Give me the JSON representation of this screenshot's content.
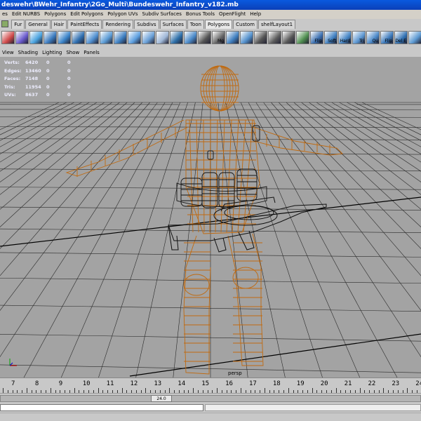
{
  "window": {
    "title": "deswehr\\BWehr_Infantry\\2Go_Multi\\Bundeswehr_Infantry_v182.mb"
  },
  "menubar": [
    "es",
    "Edit NURBS",
    "Polygons",
    "Edit Polygons",
    "Polygon UVs",
    "Subdiv Surfaces",
    "Bonus Tools",
    "OpenFlight",
    "Help"
  ],
  "shelf": {
    "tabs": [
      {
        "label": "Fur",
        "active": false
      },
      {
        "label": "General",
        "active": false
      },
      {
        "label": "Hair",
        "active": false
      },
      {
        "label": "PaintEffects",
        "active": false
      },
      {
        "label": "Rendering",
        "active": false
      },
      {
        "label": "Subdivs",
        "active": false
      },
      {
        "label": "Surfaces",
        "active": false
      },
      {
        "label": "Toon",
        "active": false
      },
      {
        "label": "Polygons",
        "active": true
      },
      {
        "label": "Custom",
        "active": false
      },
      {
        "label": "shelfLayout1",
        "active": false
      }
    ],
    "icons": [
      {
        "name": "cube-icon",
        "color": "#d04a4a",
        "label": ""
      },
      {
        "name": "cube-solid-icon",
        "color": "#6a5acd",
        "label": ""
      },
      {
        "name": "sphere-icon",
        "color": "#4aa3df",
        "label": ""
      },
      {
        "name": "cylinder-icon",
        "color": "#3b7bbf",
        "label": ""
      },
      {
        "name": "plane-icon",
        "color": "#3a83c9",
        "label": ""
      },
      {
        "name": "pipe-icon",
        "color": "#2f6fb0",
        "label": ""
      },
      {
        "name": "torus-icon",
        "color": "#4f8fd0",
        "label": ""
      },
      {
        "name": "extrude-icon",
        "color": "#5b9bd5",
        "label": ""
      },
      {
        "name": "bevel-icon",
        "color": "#3d7fc1",
        "label": ""
      },
      {
        "name": "merge-icon",
        "color": "#5d9fe0",
        "label": ""
      },
      {
        "name": "split-icon",
        "color": "#6aa0d8",
        "label": ""
      },
      {
        "name": "smooth-icon",
        "color": "#a0b8d8",
        "label": ""
      },
      {
        "name": "wedge-icon",
        "color": "#2c6ea8",
        "label": ""
      },
      {
        "name": "bridge-icon",
        "color": "#4a89c8",
        "label": ""
      },
      {
        "name": "checker-icon",
        "color": "#555555",
        "label": ""
      },
      {
        "name": "checker-icon",
        "color": "#666666",
        "label": "Mg"
      },
      {
        "name": "combine-icon",
        "color": "#3f7fc0",
        "label": ""
      },
      {
        "name": "separate-icon",
        "color": "#5290cc",
        "label": ""
      },
      {
        "name": "checker-icon",
        "color": "#555555",
        "label": ""
      },
      {
        "name": "checker-icon",
        "color": "#5c5c5c",
        "label": ""
      },
      {
        "name": "checker-icon",
        "color": "#575757",
        "label": ""
      },
      {
        "name": "grid-icon",
        "color": "#4f8f4f",
        "label": ""
      },
      {
        "name": "flip-icon",
        "color": "#3a6fb0",
        "label": "Flip"
      },
      {
        "name": "soft-icon",
        "color": "#3f7fc0",
        "label": "Soft"
      },
      {
        "name": "hard-icon",
        "color": "#4585c5",
        "label": "Hard"
      },
      {
        "name": "triangulate-icon",
        "color": "#5a95d0",
        "label": "Tri"
      },
      {
        "name": "quad-icon",
        "color": "#4a88c8",
        "label": "Qu"
      },
      {
        "name": "flip-edge-icon",
        "color": "#3b79bb",
        "label": "Flip"
      },
      {
        "name": "delete-edge-icon",
        "color": "#3171b3",
        "label": "Del E"
      },
      {
        "name": "misc-icon",
        "color": "#5d9ad3",
        "label": ""
      }
    ]
  },
  "panel_menu": [
    "View",
    "Shading",
    "Lighting",
    "Show",
    "Panels"
  ],
  "hud": [
    {
      "label": "Verts:",
      "v1": "6420",
      "v2": "0",
      "v3": "0"
    },
    {
      "label": "Edges:",
      "v1": "13460",
      "v2": "0",
      "v3": "0"
    },
    {
      "label": "Faces:",
      "v1": "7148",
      "v2": "0",
      "v3": "0"
    },
    {
      "label": "Tris:",
      "v1": "11954",
      "v2": "0",
      "v3": "0"
    },
    {
      "label": "UVs:",
      "v1": "8637",
      "v2": "0",
      "v3": "0"
    }
  ],
  "camera": "persp",
  "timeline": {
    "ticks": [
      "7",
      "8",
      "9",
      "10",
      "11",
      "12",
      "13",
      "14",
      "15",
      "16",
      "17",
      "18",
      "19",
      "20",
      "21",
      "22",
      "23",
      "24"
    ],
    "current_frame": "24.0"
  },
  "colors": {
    "wireframe": "#c06a10",
    "weapon": "#111111",
    "grid": "#2a2a2a",
    "viewport": "#a3a3a3"
  },
  "partial_tick": "7"
}
